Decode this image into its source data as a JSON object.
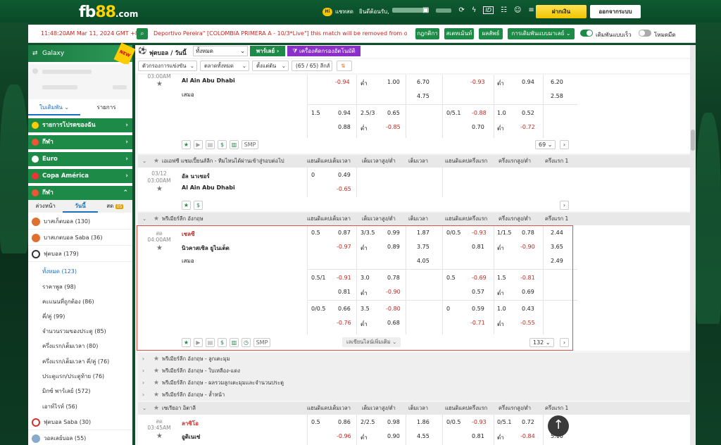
{
  "header": {
    "logo_main": "fb",
    "logo_num": "88",
    "logo_tld": ".com",
    "hi_badge": "Hi",
    "chat_label": "แชทสด",
    "welcome": "ยินดีต้อนรับ,",
    "deposit_label": "ฝากเงิน",
    "logout_label": "ออกจากระบบ",
    "accent_green": "#1e8a47",
    "accent_yellow": "#f1c500"
  },
  "infobar": {
    "datetime": "11:48:20AM Mar 11, 2024 GMT +8",
    "ticker": "Deportivo Pereira\" [COLOMBIA PRIMERA A - 10/3*Live\"] this match will be removed from our",
    "btn_rules": "กฎกติกา",
    "btn_statement": "สเตทเม้นท์",
    "btn_results": "ผลลัพธ์",
    "btn_settings": "การเดิมพันแบบมาเลย์",
    "toggle_fast": "เดิมพันแบบเร็ว",
    "toggle_dark": "โหมดมืด"
  },
  "sidebar": {
    "galaxy": "Galaxy",
    "new_badge": "NEW",
    "tab_bets": "ใบเดิมพัน",
    "tab_list": "รายการ",
    "groups": [
      {
        "label": "รายการโปรดของฉัน"
      },
      {
        "label": "กีฬา"
      },
      {
        "label": "Euro"
      },
      {
        "label": "Copa América"
      },
      {
        "label": "กีฬา"
      }
    ],
    "sub_tabs": {
      "early": "ล่วงหน้า",
      "today": "วันนี้",
      "live": "สด",
      "live_count": "05"
    },
    "sports": [
      {
        "label": "บาสเก็ตบอล",
        "count": "(130)"
      },
      {
        "label": "บาสเกตบอล Saba",
        "count": "(36)"
      },
      {
        "label": "ฟุตบอล",
        "count": "(179)"
      }
    ],
    "football_children": [
      {
        "label": "ทั้งหมด",
        "count": "(123)"
      },
      {
        "label": "ราคาพูล",
        "count": "(98)"
      },
      {
        "label": "คะแนนที่ถูกต้อง",
        "count": "(86)"
      },
      {
        "label": "คี่/คู่",
        "count": "(99)"
      },
      {
        "label": "จำนวนรวมของประตู",
        "count": "(85)"
      },
      {
        "label": "ครึ่งแรก/เต็มเวลา",
        "count": "(80)"
      },
      {
        "label": "ครึ่งแรก/เต็มเวลา คี่/คู่",
        "count": "(76)"
      },
      {
        "label": "ประตูแรก/ประตูท้าย",
        "count": "(76)"
      },
      {
        "label": "มิกซ์ พาร์เลย์",
        "count": "(572)"
      },
      {
        "label": "เอาท์ไรท์",
        "count": "(56)"
      }
    ],
    "more_sports": [
      {
        "label": "ฟุตบอล Saba",
        "count": "(30)"
      },
      {
        "label": "วอลเลย์บอล",
        "count": "(55)"
      }
    ]
  },
  "main": {
    "sport_title": "ฟุตบอล / วันนี้",
    "select_all": "ทั้งหมด",
    "btn_parlay": "พาร์เลย์",
    "btn_filter": "เครื่องคัดกรองอัตโนมัติ",
    "filter_league": "ตัวกรองการแข่งขัน",
    "filter_market": "ตลาดทั้งหมด",
    "filter_odds": "ตั้งแต่ต้น",
    "match_count": "(65 / 65) ลีกส์",
    "col_headers": [
      "แฮนดิแคปเต็มเวลา",
      "เต็มเวลาสูง/ต่ำ",
      "เต็มเวลา",
      "แฮนดิแคปครึ่งแรก",
      "ครึ่งแรกสูง/ต่ำ",
      "ครึ่งแรก 1"
    ],
    "match1": {
      "time": "03:00AM",
      "home": "Al Ain Abu Dhabi",
      "draw": "เสมอ",
      "r1": [
        "-0.94",
        "ต่ำ",
        "1.00",
        "6.70",
        "-0.93",
        "ต่ำ",
        "0.94",
        "6.20"
      ],
      "r2": [
        "4.75",
        "2.58"
      ],
      "r3": [
        "1.5",
        "0.94",
        "2.5/3",
        "0.65",
        "0/5.1",
        "-0.88",
        "1.0",
        "0.52"
      ],
      "r4": [
        "0.88",
        "ต่ำ",
        "-0.85",
        "0.70",
        "ต่ำ",
        "-0.72"
      ],
      "smp": "SMP",
      "pager": "69"
    },
    "league2": "เอเอฟซี แชมเปี้ยนส์ลีก - ทีมไหนได้ผ่านเข้าสู่รอบต่อไป",
    "match2": {
      "date": "03/12",
      "time": "03:00AM",
      "home": "อัล นาเซอร์",
      "away": "Al Ain Abu Dhabi",
      "o1": [
        "0",
        "0.49"
      ],
      "o2": "-0.65"
    },
    "league3": "พรีเมียร์ลีก อังกฤษ",
    "match3": {
      "live": "สด",
      "time": "04:00AM",
      "home": "เชลซี",
      "away": "นิวคาสเซิล ยูไนเต็ด",
      "draw": "เสมอ",
      "a1": [
        "0.5",
        "0.87",
        "3/3.5",
        "0.99",
        "1.87",
        "0/0.5",
        "-0.93",
        "1/1.5",
        "0.78",
        "2.44"
      ],
      "a2": [
        "-0.97",
        "ต่ำ",
        "0.89",
        "3.75",
        "0.81",
        "ต่ำ",
        "-0.90",
        "3.65"
      ],
      "a3": [
        "4.05",
        "2.49"
      ],
      "b1": [
        "0.5/1",
        "-0.91",
        "3.0",
        "0.78",
        "0.5",
        "-0.69",
        "1.5",
        "-0.81"
      ],
      "b2": [
        "0.81",
        "ต่ำ",
        "-0.90",
        "0.57",
        "ต่ำ",
        "0.69"
      ],
      "c1": [
        "0/0.5",
        "0.66",
        "3.5",
        "-0.80",
        "0",
        "0.59",
        "1.0",
        "0.43"
      ],
      "c2": [
        "-0.76",
        "ต่ำ",
        "0.68",
        "-0.71",
        "ต่ำ",
        "-0.55"
      ],
      "smp": "SMP",
      "more": "เลเขียนไลน์เพิ่มเติม",
      "pager": "132"
    },
    "collapsed": [
      "พรีเมียร์ลีก อังกฤษ - ลูกเตะมุม",
      "พรีเมียร์ลีก อังกฤษ - ใบเหลือง-แดง",
      "พรีเมียร์ลีก อังกฤษ - ผลรวมลูกเตะมุมและจำนวนประตู",
      "พรีเมียร์ลีก อังกฤษ - ล้ำหน้า"
    ],
    "league4": "เซเรียอา อิตาลี",
    "match4": {
      "live": "สด",
      "time": "03:45AM",
      "home": "ลาซิโอ",
      "away": "อูดิเนเซ่",
      "r1": [
        "0.5",
        "0.86",
        "2/2.5",
        "0.98",
        "1.86",
        "0/0.5",
        "-0.93",
        "0/5.1",
        "0.72"
      ],
      "r2": [
        "-0.96",
        "ต่ำ",
        "0.90",
        "4.55",
        "0.81",
        "ต่ำ",
        "-0.84",
        "5.10"
      ]
    }
  }
}
